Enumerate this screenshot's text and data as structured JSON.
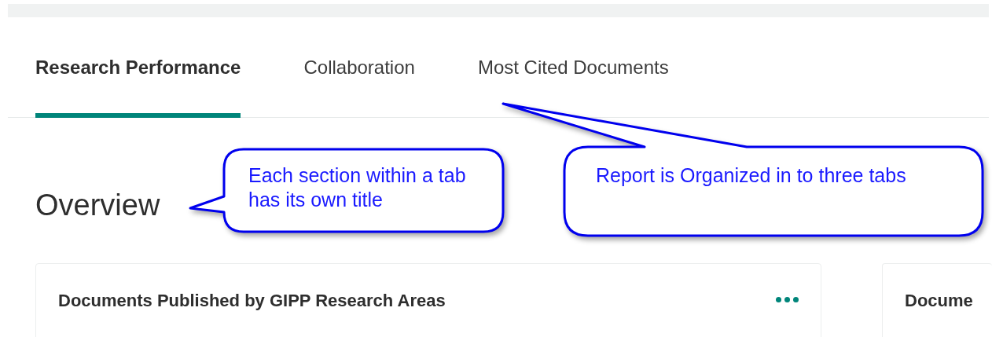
{
  "tabs": [
    {
      "label": "Research Performance",
      "selected": true
    },
    {
      "label": "Collaboration",
      "selected": false
    },
    {
      "label": "Most Cited Documents",
      "selected": false
    }
  ],
  "section_title": "Overview",
  "cards": [
    {
      "title": "Documents Published by GIPP Research Areas",
      "menu": true
    },
    {
      "title": "Docume"
    }
  ],
  "annotations": [
    {
      "text": "Each section within a tab has its own title"
    },
    {
      "text": "Report is Organized in to three tabs"
    }
  ]
}
